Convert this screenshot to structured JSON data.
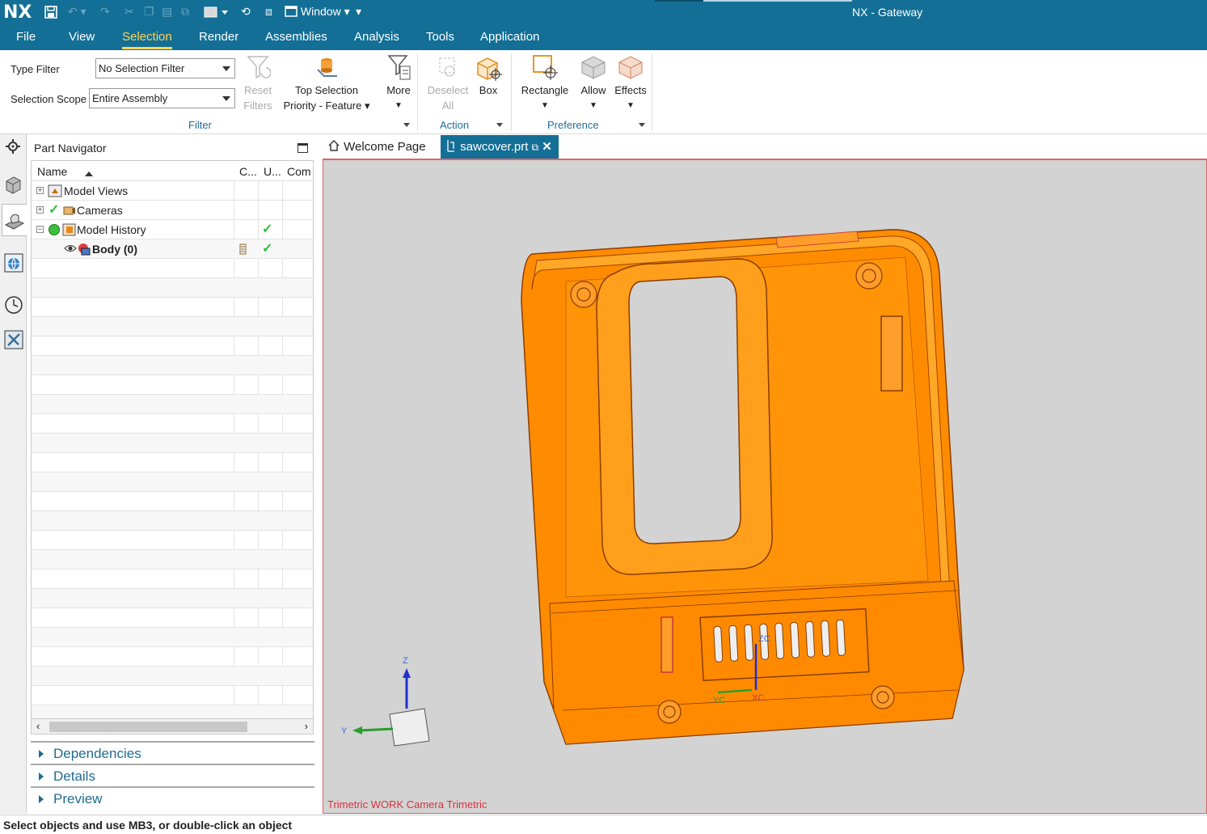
{
  "app": {
    "logo": "NX",
    "window_menu": "Window",
    "title": "NX - Gateway"
  },
  "menu": [
    {
      "label": "File"
    },
    {
      "label": "View"
    },
    {
      "label": "Selection",
      "active": true
    },
    {
      "label": "Render"
    },
    {
      "label": "Assemblies"
    },
    {
      "label": "Analysis"
    },
    {
      "label": "Tools"
    },
    {
      "label": "Application"
    }
  ],
  "ribbon": {
    "type_filter_label": "Type Filter",
    "type_filter_value": "No Selection Filter",
    "scope_label": "Selection Scope",
    "scope_value": "Entire Assembly",
    "reset_filters": [
      "Reset",
      "Filters"
    ],
    "top_selection": [
      "Top Selection",
      "Priority - Feature"
    ],
    "more": "More",
    "filter_group": "Filter",
    "deselect_all": [
      "Deselect",
      "All"
    ],
    "box": "Box",
    "action_group": "Action",
    "rectangle": "Rectangle",
    "allow": "Allow",
    "effects": "Effects",
    "preference_group": "Preference"
  },
  "navigator": {
    "title": "Part Navigator",
    "columns": {
      "name": "Name",
      "c": "C...",
      "u": "U...",
      "com": "Com"
    },
    "rows": [
      {
        "name": "Model Views"
      },
      {
        "name": "Cameras"
      },
      {
        "name": "Model History"
      },
      {
        "name": "Body (0)"
      }
    ],
    "panels": [
      "Dependencies",
      "Details",
      "Preview"
    ]
  },
  "tabs": [
    {
      "label": "Welcome Page"
    },
    {
      "label": "sawcover.prt",
      "active": true
    }
  ],
  "viewport": {
    "caption": "Trimetric WORK Camera Trimetric",
    "axes": {
      "z": "Z",
      "y": "Y",
      "zc": "ZC",
      "yc": "YC",
      "xc": "XC"
    },
    "model_color": "#ff8c00"
  },
  "status": "Select objects and use MB3, or double-click an object"
}
